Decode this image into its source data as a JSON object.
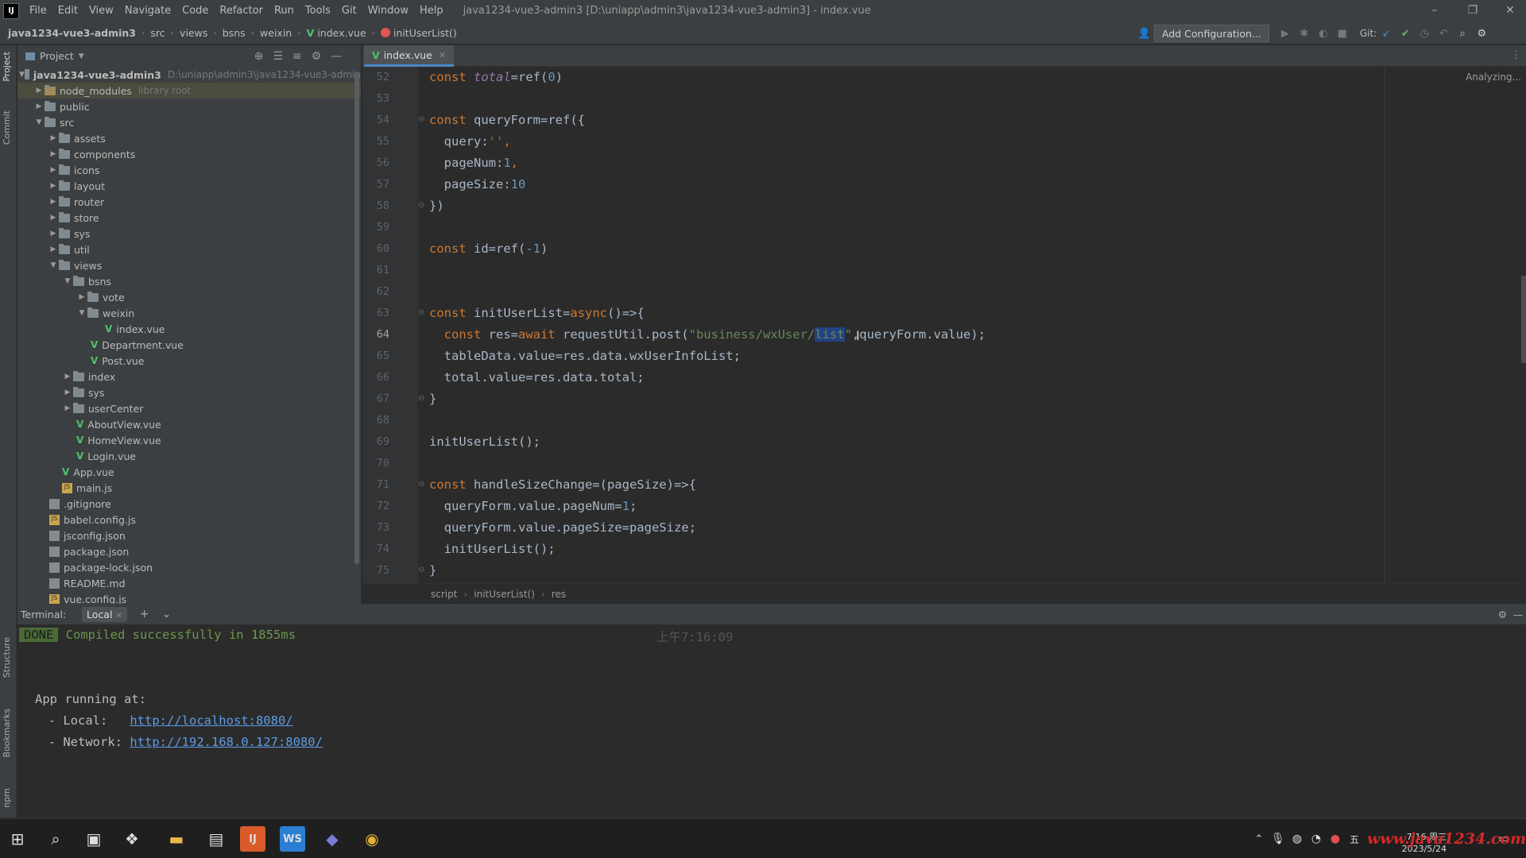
{
  "menubar": {
    "items": [
      "File",
      "Edit",
      "View",
      "Navigate",
      "Code",
      "Refactor",
      "Run",
      "Tools",
      "Git",
      "Window",
      "Help"
    ],
    "title": "java1234-vue3-admin3 [D:\\uniapp\\admin3\\java1234-vue3-admin3] - index.vue"
  },
  "navbar": {
    "crumbs": [
      "java1234-vue3-admin3",
      "src",
      "views",
      "bsns",
      "weixin",
      "index.vue",
      "initUserList()"
    ],
    "add_config": "Add Configuration...",
    "git_label": "Git:"
  },
  "project": {
    "header": "Project",
    "root": "java1234-vue3-admin3",
    "root_path": "D:\\uniapp\\admin3\\java1234-vue3-admin",
    "node_modules": "node_modules",
    "node_modules_note": "library root",
    "items": [
      "public",
      "src",
      "assets",
      "components",
      "icons",
      "layout",
      "router",
      "store",
      "sys",
      "util",
      "views",
      "bsns",
      "vote",
      "weixin",
      "index.vue",
      "Department.vue",
      "Post.vue",
      "index",
      "sys",
      "userCenter",
      "AboutView.vue",
      "HomeView.vue",
      "Login.vue",
      "App.vue",
      "main.js",
      ".gitignore",
      "babel.config.js",
      "jsconfig.json",
      "package.json",
      "package-lock.json",
      "README.md",
      "vue.config.js"
    ]
  },
  "editor": {
    "tab": "index.vue",
    "status": "Analyzing...",
    "lines": [
      "52",
      "53",
      "54",
      "55",
      "56",
      "57",
      "58",
      "59",
      "60",
      "61",
      "62",
      "63",
      "64",
      "65",
      "66",
      "67",
      "68",
      "69",
      "70",
      "71",
      "72",
      "73",
      "74",
      "75"
    ],
    "code": {
      "l52a": "const ",
      "l52b": "total",
      "l52c": "=ref(",
      "l52d": "0",
      "l52e": ")",
      "l54a": "const ",
      "l54b": "queryForm=ref({",
      "l55a": "  query:",
      "l55b": "''",
      "l55c": ",",
      "l56a": "  pageNum:",
      "l56b": "1",
      "l56c": ",",
      "l57a": "  pageSize:",
      "l57b": "10",
      "l58": "})",
      "l60a": "const ",
      "l60b": "id=ref(",
      "l60c": "-1",
      "l60d": ")",
      "l63a": "const ",
      "l63b": "initUserList=",
      "l63c": "async",
      "l63d": "()=>{",
      "l64a": "  const ",
      "l64b": "res=",
      "l64c": "await ",
      "l64d": "requestUtil.post(",
      "l64e": "\"business/wxUser/",
      "l64f": "list",
      "l64g": "\"",
      "l64h": ",queryForm.value);",
      "l65": "  tableData.value=res.data.wxUserInfoList;",
      "l66": "  total.value=res.data.total;",
      "l67": "}",
      "l69": "initUserList();",
      "l71a": "const ",
      "l71b": "handleSizeChange=(pageSize)=>{",
      "l72a": "  queryForm.value.pageNum=",
      "l72b": "1",
      "l72c": ";",
      "l73": "  queryForm.value.pageSize=pageSize;",
      "l74": "  initUserList();",
      "l75": "}"
    },
    "breadcrumbs": [
      "script",
      "initUserList()",
      "res"
    ]
  },
  "terminal": {
    "label": "Terminal:",
    "tab": "Local",
    "done": "DONE",
    "compiled": "Compiled successfully in 1855ms",
    "time": "上午7:16:09",
    "running": "App running at:",
    "local_label": "  - Local:   ",
    "local_url": "http://localhost:8080/",
    "network_label": "  - Network: ",
    "network_url": "http://192.168.0.127:8080/"
  },
  "sidebar_tabs": [
    "Project",
    "Commit",
    "Structure",
    "Bookmarks",
    "npm"
  ],
  "taskbar": {
    "time": "7:16 周三",
    "date": "2023/5/24",
    "watermark": "www.java1234.com"
  }
}
